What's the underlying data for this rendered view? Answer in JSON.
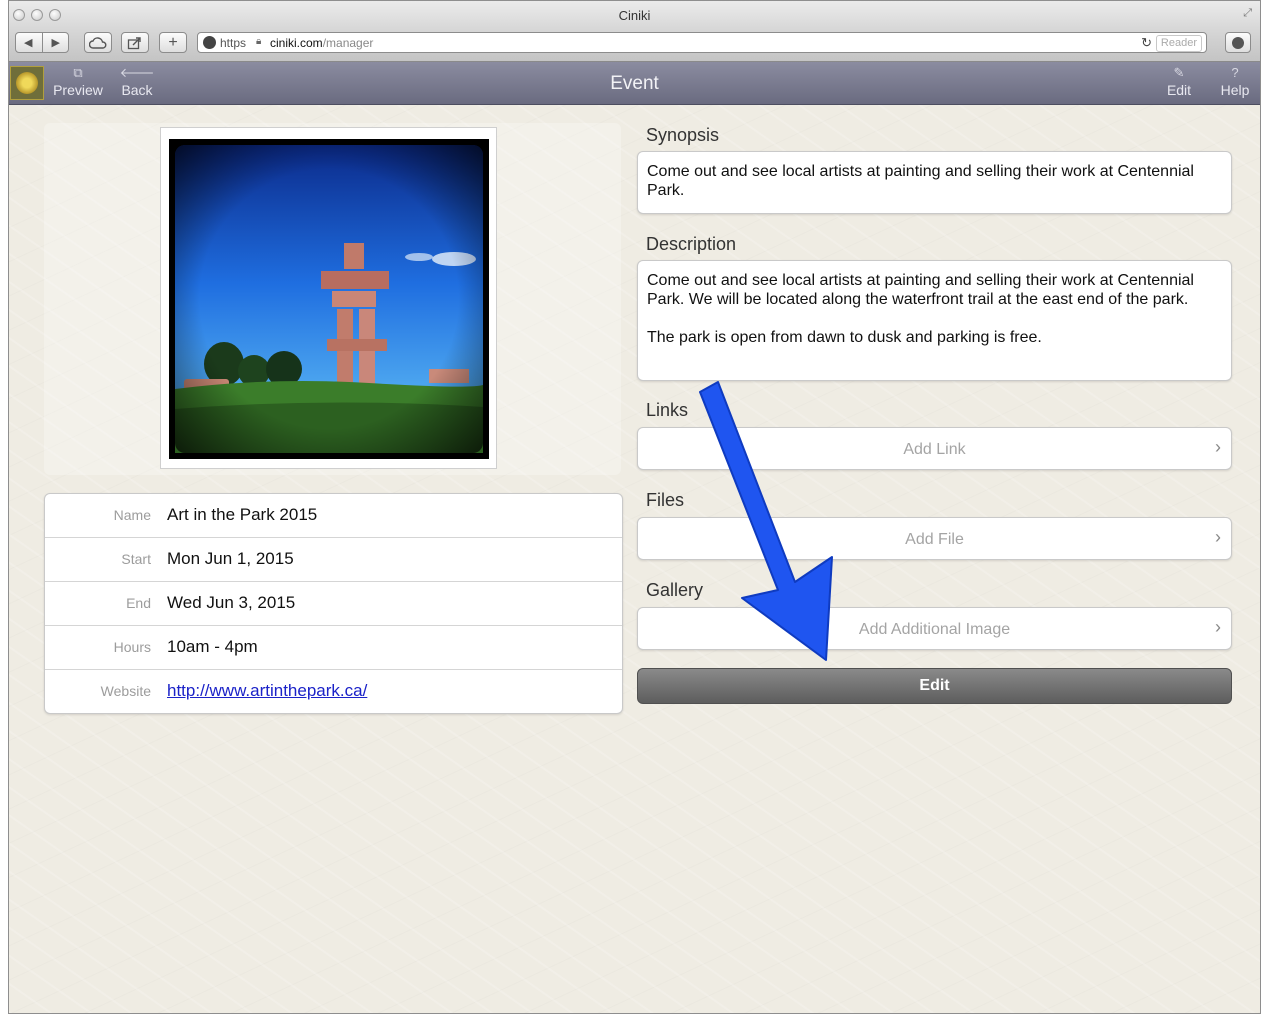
{
  "window": {
    "title": "Ciniki"
  },
  "urlbar": {
    "scheme": "https",
    "host": "ciniki.com",
    "path": "/manager",
    "reader_label": "Reader"
  },
  "appbar": {
    "title": "Event",
    "preview_label": "Preview",
    "back_label": "Back",
    "edit_label": "Edit",
    "help_label": "Help",
    "help_glyph": "?"
  },
  "details": {
    "rows": [
      {
        "label": "Name",
        "value": "Art in the Park 2015"
      },
      {
        "label": "Start",
        "value": "Mon Jun 1, 2015"
      },
      {
        "label": "End",
        "value": "Wed Jun 3, 2015"
      },
      {
        "label": "Hours",
        "value": "10am - 4pm"
      },
      {
        "label": "Website",
        "value": "http://www.artinthepark.ca/"
      }
    ]
  },
  "synopsis": {
    "title": "Synopsis",
    "text": "Come out and see local artists at painting and selling their work at Centennial Park."
  },
  "description": {
    "title": "Description",
    "paragraph1": "Come out and see local artists at painting and selling their work at Centennial Park. We will be located along the waterfront trail at the east end of the park.",
    "paragraph2": "The park is open from dawn to dusk and parking is free."
  },
  "links": {
    "title": "Links",
    "add_label": "Add Link"
  },
  "files": {
    "title": "Files",
    "add_label": "Add File"
  },
  "gallery": {
    "title": "Gallery",
    "add_label": "Add Additional Image"
  },
  "edit_button": {
    "label": "Edit"
  },
  "colors": {
    "annotation_arrow": "#1f55f0",
    "appbar": "#7a7b90",
    "link": "#1b22c8"
  }
}
